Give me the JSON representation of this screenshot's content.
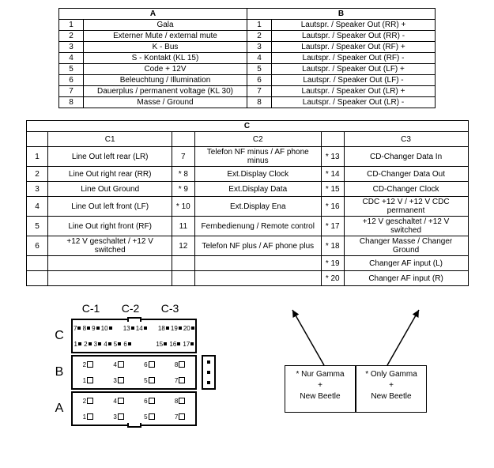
{
  "table1": {
    "headerA": "A",
    "headerB": "B",
    "rows": [
      {
        "n": "1",
        "a": "Gala",
        "b": "Lautspr. / Speaker Out (RR) +"
      },
      {
        "n": "2",
        "a": "Externer Mute / external mute",
        "b": "Lautspr. / Speaker Out (RR) -"
      },
      {
        "n": "3",
        "a": "K - Bus",
        "b": "Lautspr. / Speaker Out (RF) +"
      },
      {
        "n": "4",
        "a": "S - Kontakt (KL 15)",
        "b": "Lautspr. / Speaker Out (RF) -"
      },
      {
        "n": "5",
        "a": "Code + 12V",
        "b": "Lautspr. / Speaker Out (LF) +"
      },
      {
        "n": "6",
        "a": "Beleuchtung / Illumination",
        "b": "Lautspr. / Speaker Out (LF) -"
      },
      {
        "n": "7",
        "a": "Dauerplus / permanent voltage (KL 30)",
        "b": "Lautspr. / Speaker Out (LR) +"
      },
      {
        "n": "8",
        "a": "Masse / Ground",
        "b": "Lautspr. / Speaker Out (LR) -"
      }
    ]
  },
  "table2": {
    "headerC": "C",
    "sub": {
      "c1": "C1",
      "c2": "C2",
      "c3": "C3"
    },
    "rows": [
      {
        "n1": "1",
        "d1": "Line Out left rear (LR)",
        "n2": "7",
        "d2": "Telefon NF minus / AF phone minus",
        "n3": "* 13",
        "d3": "CD-Changer Data In"
      },
      {
        "n1": "2",
        "d1": "Line Out right rear (RR)",
        "n2": "* 8",
        "d2": "Ext.Display Clock",
        "n3": "* 14",
        "d3": "CD-Changer Data Out"
      },
      {
        "n1": "3",
        "d1": "Line Out Ground",
        "n2": "* 9",
        "d2": "Ext.Display Data",
        "n3": "* 15",
        "d3": "CD-Changer Clock"
      },
      {
        "n1": "4",
        "d1": "Line Out left front (LF)",
        "n2": "* 10",
        "d2": "Ext.Display Ena",
        "n3": "* 16",
        "d3": "CDC +12 V / +12 V CDC permanent"
      },
      {
        "n1": "5",
        "d1": "Line Out right front (RF)",
        "n2": "11",
        "d2": "Fernbedienung / Remote control",
        "n3": "* 17",
        "d3": "+12 V geschaltet / +12 V switched"
      },
      {
        "n1": "6",
        "d1": "+12 V geschaltet / +12 V switched",
        "n2": "12",
        "d2": "Telefon NF plus / AF phone plus",
        "n3": "* 18",
        "d3": "Changer Masse / Changer Ground"
      },
      {
        "n1": "",
        "d1": "",
        "n2": "",
        "d2": "",
        "n3": "* 19",
        "d3": "Changer AF input (L)"
      },
      {
        "n1": "",
        "d1": "",
        "n2": "",
        "d2": "",
        "n3": "* 20",
        "d3": "Changer AF input (R)"
      }
    ]
  },
  "connector": {
    "topLabels": [
      "C-1",
      "C-2",
      "C-3"
    ],
    "sideLabels": [
      "C",
      "B",
      "A"
    ],
    "rowC_top": [
      "7",
      "8",
      "9",
      "10",
      "",
      "",
      "13",
      "14",
      "",
      "",
      "18",
      "19",
      "20"
    ],
    "rowC_bot": [
      "1",
      "2",
      "3",
      "4",
      "5",
      "6",
      "",
      "",
      "",
      "",
      "15",
      "16",
      "17"
    ],
    "rowB_top": [
      "2",
      "4",
      "6",
      "8"
    ],
    "rowB_bot": [
      "1",
      "3",
      "5",
      "7"
    ],
    "rowA_top": [
      "2",
      "4",
      "6",
      "8"
    ],
    "rowA_bot": [
      "1",
      "3",
      "5",
      "7"
    ]
  },
  "notes": {
    "left_line1": "* Nur Gamma",
    "left_line2": "+",
    "left_line3": "New Beetle",
    "right_line1": "* Only Gamma",
    "right_line2": "+",
    "right_line3": "New Beetle"
  }
}
